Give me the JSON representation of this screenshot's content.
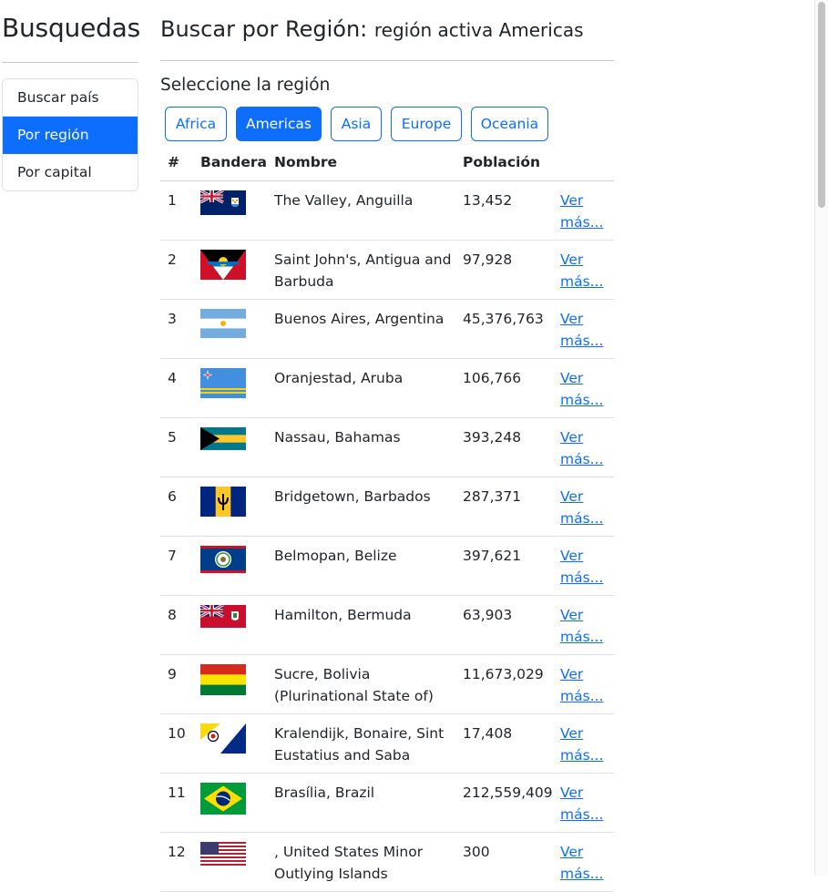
{
  "sidebar": {
    "title": "Busquedas",
    "items": [
      {
        "label": "Buscar país",
        "active": false
      },
      {
        "label": "Por región",
        "active": true
      },
      {
        "label": "Por capital",
        "active": false
      }
    ]
  },
  "main": {
    "title_prefix": "Buscar por Región: ",
    "title_suffix": "región activa Americas",
    "section_label": "Seleccione la región",
    "regions": [
      {
        "label": "Africa",
        "active": false
      },
      {
        "label": "Americas",
        "active": true
      },
      {
        "label": "Asia",
        "active": false
      },
      {
        "label": "Europe",
        "active": false
      },
      {
        "label": "Oceania",
        "active": false
      }
    ],
    "table": {
      "headers": {
        "num": "#",
        "flag": "Bandera",
        "name": "Nombre",
        "population": "Población"
      },
      "link_label_1": "Ver",
      "link_label_2": "más...",
      "rows": [
        {
          "num": "1",
          "flag": "anguilla-flag-icon",
          "name": "The Valley, Anguilla",
          "population": "13,452"
        },
        {
          "num": "2",
          "flag": "antigua-barbuda-flag-icon",
          "name": "Saint John's, Antigua and Barbuda",
          "population": "97,928"
        },
        {
          "num": "3",
          "flag": "argentina-flag-icon",
          "name": "Buenos Aires, Argentina",
          "population": "45,376,763"
        },
        {
          "num": "4",
          "flag": "aruba-flag-icon",
          "name": "Oranjestad, Aruba",
          "population": "106,766"
        },
        {
          "num": "5",
          "flag": "bahamas-flag-icon",
          "name": "Nassau, Bahamas",
          "population": "393,248"
        },
        {
          "num": "6",
          "flag": "barbados-flag-icon",
          "name": "Bridgetown, Barbados",
          "population": "287,371"
        },
        {
          "num": "7",
          "flag": "belize-flag-icon",
          "name": "Belmopan, Belize",
          "population": "397,621"
        },
        {
          "num": "8",
          "flag": "bermuda-flag-icon",
          "name": "Hamilton, Bermuda",
          "population": "63,903"
        },
        {
          "num": "9",
          "flag": "bolivia-flag-icon",
          "name": "Sucre, Bolivia (Plurinational State of)",
          "population": "11,673,029"
        },
        {
          "num": "10",
          "flag": "bonaire-flag-icon",
          "name": "Kralendijk, Bonaire, Sint Eustatius and Saba",
          "population": "17,408"
        },
        {
          "num": "11",
          "flag": "brazil-flag-icon",
          "name": "Brasília, Brazil",
          "population": "212,559,409"
        },
        {
          "num": "12",
          "flag": "usa-flag-icon",
          "name": ", United States Minor Outlying Islands",
          "population": "300"
        }
      ]
    }
  },
  "colors": {
    "primary": "#0d6efd",
    "text": "#212529",
    "border": "#dee2e6"
  }
}
